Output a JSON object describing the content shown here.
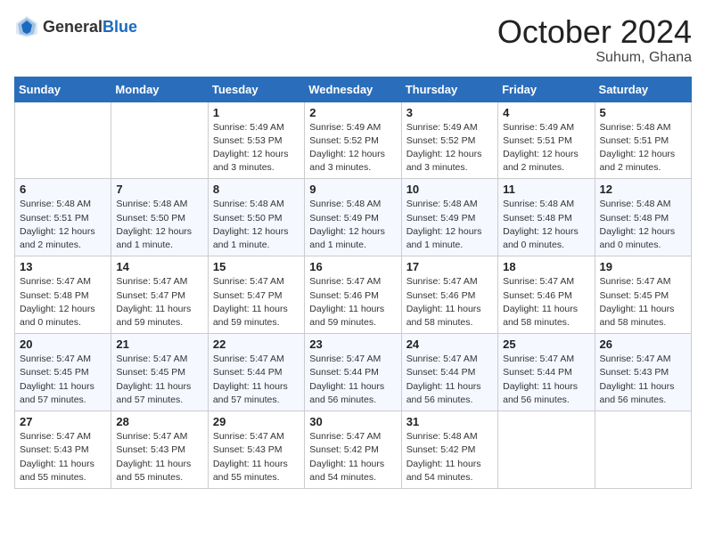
{
  "header": {
    "logo_general": "General",
    "logo_blue": "Blue",
    "month_title": "October 2024",
    "location": "Suhum, Ghana"
  },
  "weekdays": [
    "Sunday",
    "Monday",
    "Tuesday",
    "Wednesday",
    "Thursday",
    "Friday",
    "Saturday"
  ],
  "weeks": [
    [
      {
        "day": "",
        "sunrise": "",
        "sunset": "",
        "daylight": ""
      },
      {
        "day": "",
        "sunrise": "",
        "sunset": "",
        "daylight": ""
      },
      {
        "day": "1",
        "sunrise": "Sunrise: 5:49 AM",
        "sunset": "Sunset: 5:53 PM",
        "daylight": "Daylight: 12 hours and 3 minutes."
      },
      {
        "day": "2",
        "sunrise": "Sunrise: 5:49 AM",
        "sunset": "Sunset: 5:52 PM",
        "daylight": "Daylight: 12 hours and 3 minutes."
      },
      {
        "day": "3",
        "sunrise": "Sunrise: 5:49 AM",
        "sunset": "Sunset: 5:52 PM",
        "daylight": "Daylight: 12 hours and 3 minutes."
      },
      {
        "day": "4",
        "sunrise": "Sunrise: 5:49 AM",
        "sunset": "Sunset: 5:51 PM",
        "daylight": "Daylight: 12 hours and 2 minutes."
      },
      {
        "day": "5",
        "sunrise": "Sunrise: 5:48 AM",
        "sunset": "Sunset: 5:51 PM",
        "daylight": "Daylight: 12 hours and 2 minutes."
      }
    ],
    [
      {
        "day": "6",
        "sunrise": "Sunrise: 5:48 AM",
        "sunset": "Sunset: 5:51 PM",
        "daylight": "Daylight: 12 hours and 2 minutes."
      },
      {
        "day": "7",
        "sunrise": "Sunrise: 5:48 AM",
        "sunset": "Sunset: 5:50 PM",
        "daylight": "Daylight: 12 hours and 1 minute."
      },
      {
        "day": "8",
        "sunrise": "Sunrise: 5:48 AM",
        "sunset": "Sunset: 5:50 PM",
        "daylight": "Daylight: 12 hours and 1 minute."
      },
      {
        "day": "9",
        "sunrise": "Sunrise: 5:48 AM",
        "sunset": "Sunset: 5:49 PM",
        "daylight": "Daylight: 12 hours and 1 minute."
      },
      {
        "day": "10",
        "sunrise": "Sunrise: 5:48 AM",
        "sunset": "Sunset: 5:49 PM",
        "daylight": "Daylight: 12 hours and 1 minute."
      },
      {
        "day": "11",
        "sunrise": "Sunrise: 5:48 AM",
        "sunset": "Sunset: 5:48 PM",
        "daylight": "Daylight: 12 hours and 0 minutes."
      },
      {
        "day": "12",
        "sunrise": "Sunrise: 5:48 AM",
        "sunset": "Sunset: 5:48 PM",
        "daylight": "Daylight: 12 hours and 0 minutes."
      }
    ],
    [
      {
        "day": "13",
        "sunrise": "Sunrise: 5:47 AM",
        "sunset": "Sunset: 5:48 PM",
        "daylight": "Daylight: 12 hours and 0 minutes."
      },
      {
        "day": "14",
        "sunrise": "Sunrise: 5:47 AM",
        "sunset": "Sunset: 5:47 PM",
        "daylight": "Daylight: 11 hours and 59 minutes."
      },
      {
        "day": "15",
        "sunrise": "Sunrise: 5:47 AM",
        "sunset": "Sunset: 5:47 PM",
        "daylight": "Daylight: 11 hours and 59 minutes."
      },
      {
        "day": "16",
        "sunrise": "Sunrise: 5:47 AM",
        "sunset": "Sunset: 5:46 PM",
        "daylight": "Daylight: 11 hours and 59 minutes."
      },
      {
        "day": "17",
        "sunrise": "Sunrise: 5:47 AM",
        "sunset": "Sunset: 5:46 PM",
        "daylight": "Daylight: 11 hours and 58 minutes."
      },
      {
        "day": "18",
        "sunrise": "Sunrise: 5:47 AM",
        "sunset": "Sunset: 5:46 PM",
        "daylight": "Daylight: 11 hours and 58 minutes."
      },
      {
        "day": "19",
        "sunrise": "Sunrise: 5:47 AM",
        "sunset": "Sunset: 5:45 PM",
        "daylight": "Daylight: 11 hours and 58 minutes."
      }
    ],
    [
      {
        "day": "20",
        "sunrise": "Sunrise: 5:47 AM",
        "sunset": "Sunset: 5:45 PM",
        "daylight": "Daylight: 11 hours and 57 minutes."
      },
      {
        "day": "21",
        "sunrise": "Sunrise: 5:47 AM",
        "sunset": "Sunset: 5:45 PM",
        "daylight": "Daylight: 11 hours and 57 minutes."
      },
      {
        "day": "22",
        "sunrise": "Sunrise: 5:47 AM",
        "sunset": "Sunset: 5:44 PM",
        "daylight": "Daylight: 11 hours and 57 minutes."
      },
      {
        "day": "23",
        "sunrise": "Sunrise: 5:47 AM",
        "sunset": "Sunset: 5:44 PM",
        "daylight": "Daylight: 11 hours and 56 minutes."
      },
      {
        "day": "24",
        "sunrise": "Sunrise: 5:47 AM",
        "sunset": "Sunset: 5:44 PM",
        "daylight": "Daylight: 11 hours and 56 minutes."
      },
      {
        "day": "25",
        "sunrise": "Sunrise: 5:47 AM",
        "sunset": "Sunset: 5:44 PM",
        "daylight": "Daylight: 11 hours and 56 minutes."
      },
      {
        "day": "26",
        "sunrise": "Sunrise: 5:47 AM",
        "sunset": "Sunset: 5:43 PM",
        "daylight": "Daylight: 11 hours and 56 minutes."
      }
    ],
    [
      {
        "day": "27",
        "sunrise": "Sunrise: 5:47 AM",
        "sunset": "Sunset: 5:43 PM",
        "daylight": "Daylight: 11 hours and 55 minutes."
      },
      {
        "day": "28",
        "sunrise": "Sunrise: 5:47 AM",
        "sunset": "Sunset: 5:43 PM",
        "daylight": "Daylight: 11 hours and 55 minutes."
      },
      {
        "day": "29",
        "sunrise": "Sunrise: 5:47 AM",
        "sunset": "Sunset: 5:43 PM",
        "daylight": "Daylight: 11 hours and 55 minutes."
      },
      {
        "day": "30",
        "sunrise": "Sunrise: 5:47 AM",
        "sunset": "Sunset: 5:42 PM",
        "daylight": "Daylight: 11 hours and 54 minutes."
      },
      {
        "day": "31",
        "sunrise": "Sunrise: 5:48 AM",
        "sunset": "Sunset: 5:42 PM",
        "daylight": "Daylight: 11 hours and 54 minutes."
      },
      {
        "day": "",
        "sunrise": "",
        "sunset": "",
        "daylight": ""
      },
      {
        "day": "",
        "sunrise": "",
        "sunset": "",
        "daylight": ""
      }
    ]
  ]
}
